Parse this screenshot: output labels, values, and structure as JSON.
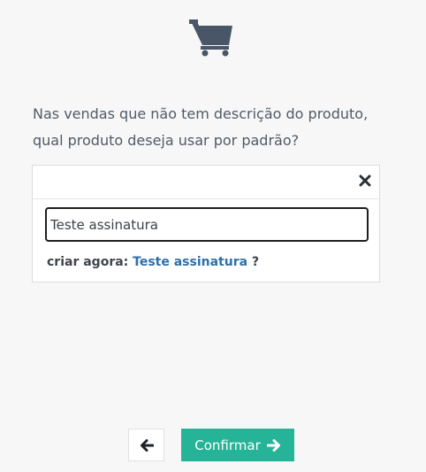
{
  "icons": {
    "header": "shopping-cart-icon",
    "clear": "close-icon",
    "back": "arrow-left-icon",
    "confirm": "arrow-right-icon"
  },
  "colors": {
    "icon": "#485667",
    "text": "#505a66",
    "link": "#2f6fa8",
    "accent": "#26b498",
    "background": "#f7f7f7"
  },
  "question": {
    "line1": "Nas vendas que não tem descrição do produto,",
    "line2": "qual produto deseja usar por padrão?"
  },
  "select": {
    "search_value": "Teste assinatura",
    "create_prefix": "criar agora:",
    "create_value": "Teste assinatura",
    "create_suffix": "?"
  },
  "footer": {
    "confirm_label": "Confirmar"
  }
}
